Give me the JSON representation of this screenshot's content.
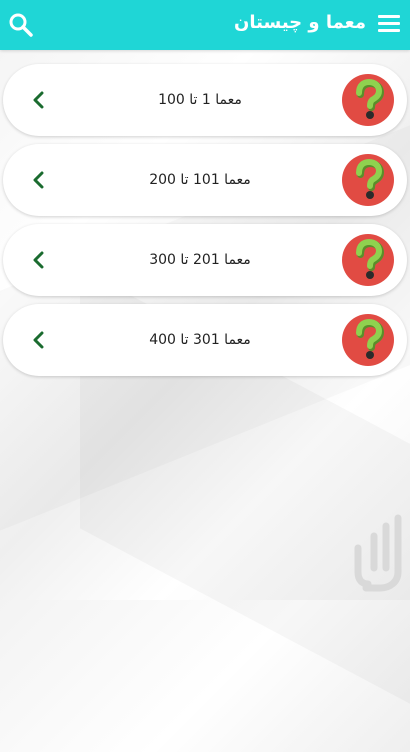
{
  "header": {
    "title": "معما و چیستان",
    "menu_icon": "hamburger-menu-icon",
    "search_icon": "search-icon"
  },
  "items": [
    {
      "label": "معما 1 تا 100"
    },
    {
      "label": "معما 101 تا 200"
    },
    {
      "label": "معما 201 تا 300"
    },
    {
      "label": "معما 301 تا 400"
    }
  ],
  "colors": {
    "appbar": "#1fd6d6",
    "chevron": "#1a6b2f",
    "icon_circle": "#e14b43",
    "question_mark": "#7bc23a"
  }
}
